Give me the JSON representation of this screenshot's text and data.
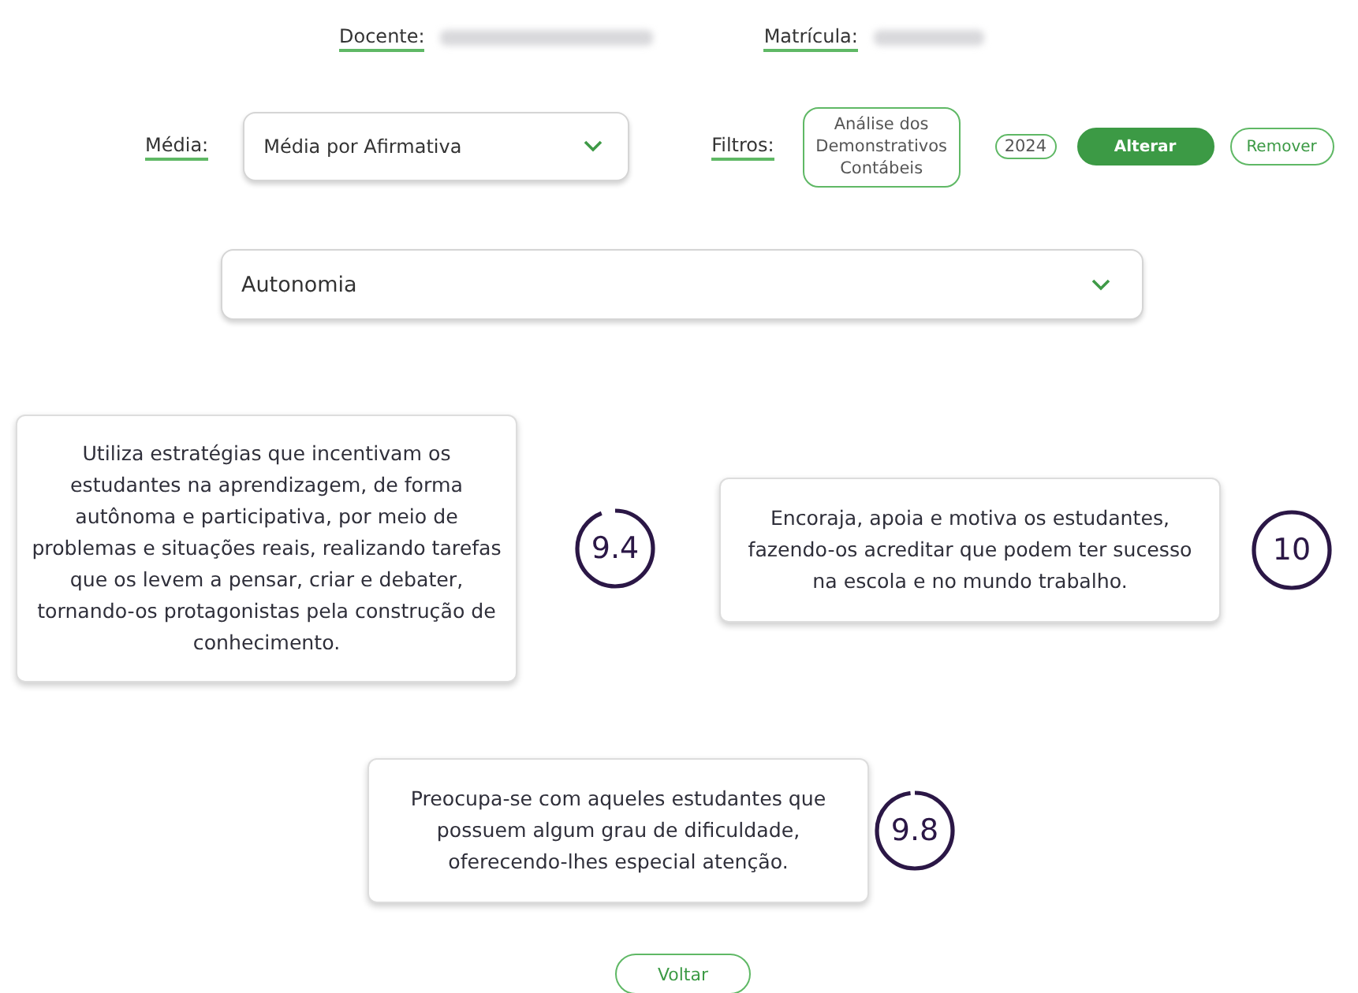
{
  "header": {
    "teacher_label": "Docente:",
    "enrollment_label": "Matrícula:"
  },
  "filters": {
    "average_label": "Média:",
    "average_value": "Média por Afirmativa",
    "filters_label": "Filtros:",
    "chips": [
      "Análise dos Demonstrativos Contábeis",
      "2024"
    ],
    "buttons": [
      {
        "label": "Alterar",
        "kind": "primary"
      },
      {
        "label": "Remover",
        "kind": "outline"
      }
    ]
  },
  "category": {
    "value": "Autonomia"
  },
  "items": [
    {
      "text": "Utiliza estratégias que incentivam os estudantes na aprendizagem, de forma autônoma e participativa, por meio de problemas e situações reais, realizando tarefas que os levem a pensar, criar e debater, tornando-os protagonistas pela construção de conhecimento.",
      "score": "9.4",
      "level": 0.94
    },
    {
      "text": "Encoraja, apoia e motiva os estudantes, fazendo-os acreditar que podem ter sucesso na escola e no mundo trabalho.",
      "score": "10",
      "level": 1.0
    },
    {
      "text": "Preocupa-se com aqueles estudantes que possuem algum grau de dificuldade, oferecendo-lhes especial atenção.",
      "score": "9.8",
      "level": 0.98
    }
  ],
  "back_button": "Voltar"
}
